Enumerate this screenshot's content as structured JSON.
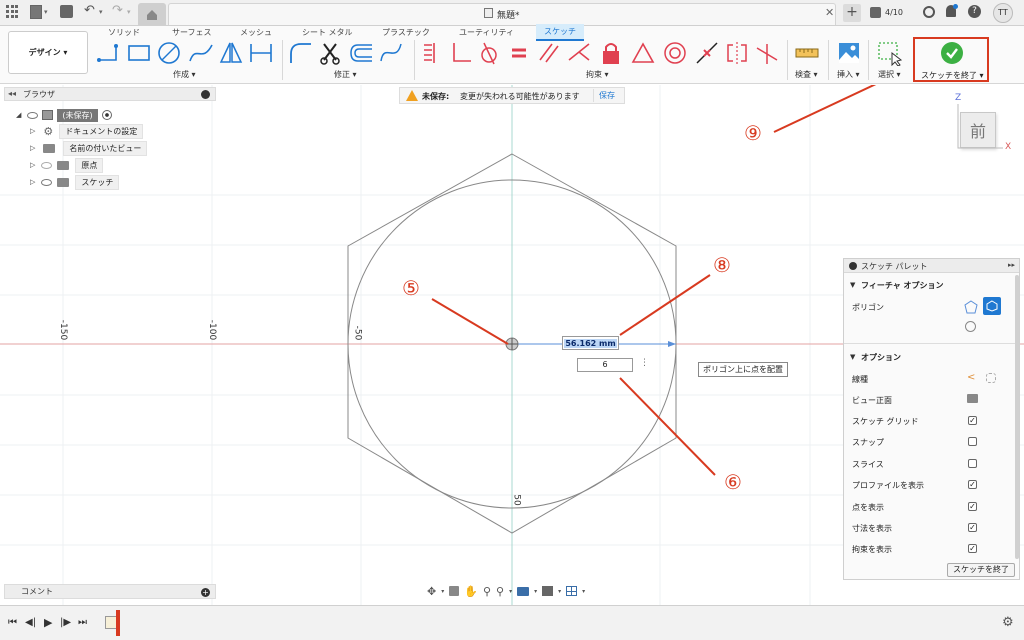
{
  "titlebar": {
    "doc_title": "無題*",
    "job_count": "4/10",
    "user_initials": "TT"
  },
  "toolbar": {
    "workspace_label": "デザイン ▾",
    "tabs": [
      "ソリッド",
      "サーフェス",
      "メッシュ",
      "シート メタル",
      "プラスチック",
      "ユーティリティ",
      "スケッチ"
    ],
    "active_tab": "スケッチ",
    "groups": {
      "create": "作成 ▾",
      "modify": "修正 ▾",
      "constraints": "拘束 ▾",
      "inspect": "検査 ▾",
      "insert": "挿入 ▾",
      "select": "選択 ▾",
      "finish_sketch": "スケッチを終了 ▾"
    }
  },
  "notice": {
    "unsaved_label": "未保存:",
    "message": "変更が失われる可能性があります",
    "save_button": "保存"
  },
  "browser": {
    "title": "ブラウザ",
    "items": [
      {
        "label": "(未保存)",
        "level": 0
      },
      {
        "label": "ドキュメントの設定",
        "level": 1
      },
      {
        "label": "名前の付いたビュー",
        "level": 1
      },
      {
        "label": "原点",
        "level": 1
      },
      {
        "label": "スケッチ",
        "level": 1
      }
    ]
  },
  "comments": {
    "title": "コメント"
  },
  "canvas": {
    "axis_labels": [
      "-150",
      "-100",
      "-50",
      "50"
    ],
    "dimension_value": "56.162 mm",
    "sides_value": "6",
    "tooltip": "ポリゴン上に点を配置",
    "viewcube_label": "前",
    "axis_z": "Z",
    "axis_x": "X"
  },
  "callouts": [
    "⑤",
    "⑥",
    "⑧",
    "⑨"
  ],
  "palette": {
    "title": "スケッチ パレット",
    "feature_section": "フィーチャ オプション",
    "polygon_label": "ポリゴン",
    "options_section": "オプション",
    "linetype_label": "線種",
    "view_front_label": "ビュー正面",
    "options": [
      {
        "label": "スケッチ グリッド",
        "checked": true
      },
      {
        "label": "スナップ",
        "checked": false
      },
      {
        "label": "スライス",
        "checked": false
      },
      {
        "label": "プロファイルを表示",
        "checked": true
      },
      {
        "label": "点を表示",
        "checked": true
      },
      {
        "label": "寸法を表示",
        "checked": true
      },
      {
        "label": "拘束を表示",
        "checked": true
      }
    ],
    "finish_button": "スケッチを終了"
  },
  "colors": {
    "accent_blue": "#1f78d1",
    "callout_red": "#d83a20",
    "finish_green": "#3cb043",
    "constraint_red": "#e04050"
  }
}
